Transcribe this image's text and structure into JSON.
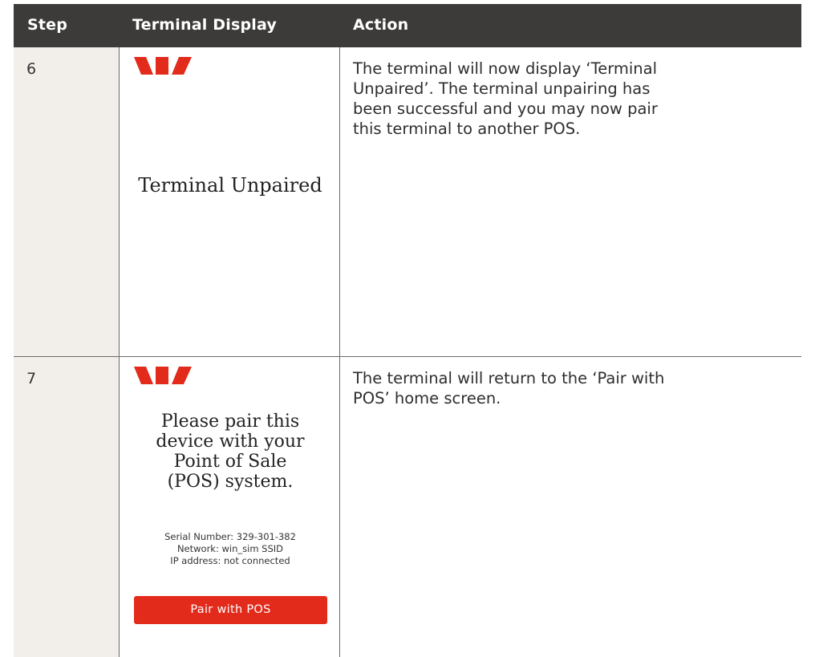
{
  "header": {
    "col_step": "Step",
    "col_display": "Terminal Display",
    "col_action": "Action"
  },
  "brand": {
    "logo_color": "#e32b1c",
    "logo_icon": "westpac-w-logo"
  },
  "rows": [
    {
      "step": "6",
      "screen_text": "Terminal Unpaired",
      "action_lines": [
        "The terminal will now display ‘Terminal",
        "Unpaired’. The terminal unpairing has",
        "been successful and you may now pair",
        "this terminal to another POS."
      ]
    },
    {
      "step": "7",
      "prompt_lines": [
        "Please pair this",
        "device with your",
        "Point of Sale",
        "(POS) system."
      ],
      "info_lines": [
        "Serial Number: 329-301-382",
        "Network: win_sim SSID",
        "IP address: not connected"
      ],
      "button_label": "Pair with POS",
      "action_lines": [
        "The terminal will return to the ‘Pair with",
        "POS’ home screen."
      ]
    }
  ],
  "colors": {
    "header_bg": "#3c3b39",
    "step_bg": "#f2efeb",
    "button_bg": "#e32b1c"
  }
}
